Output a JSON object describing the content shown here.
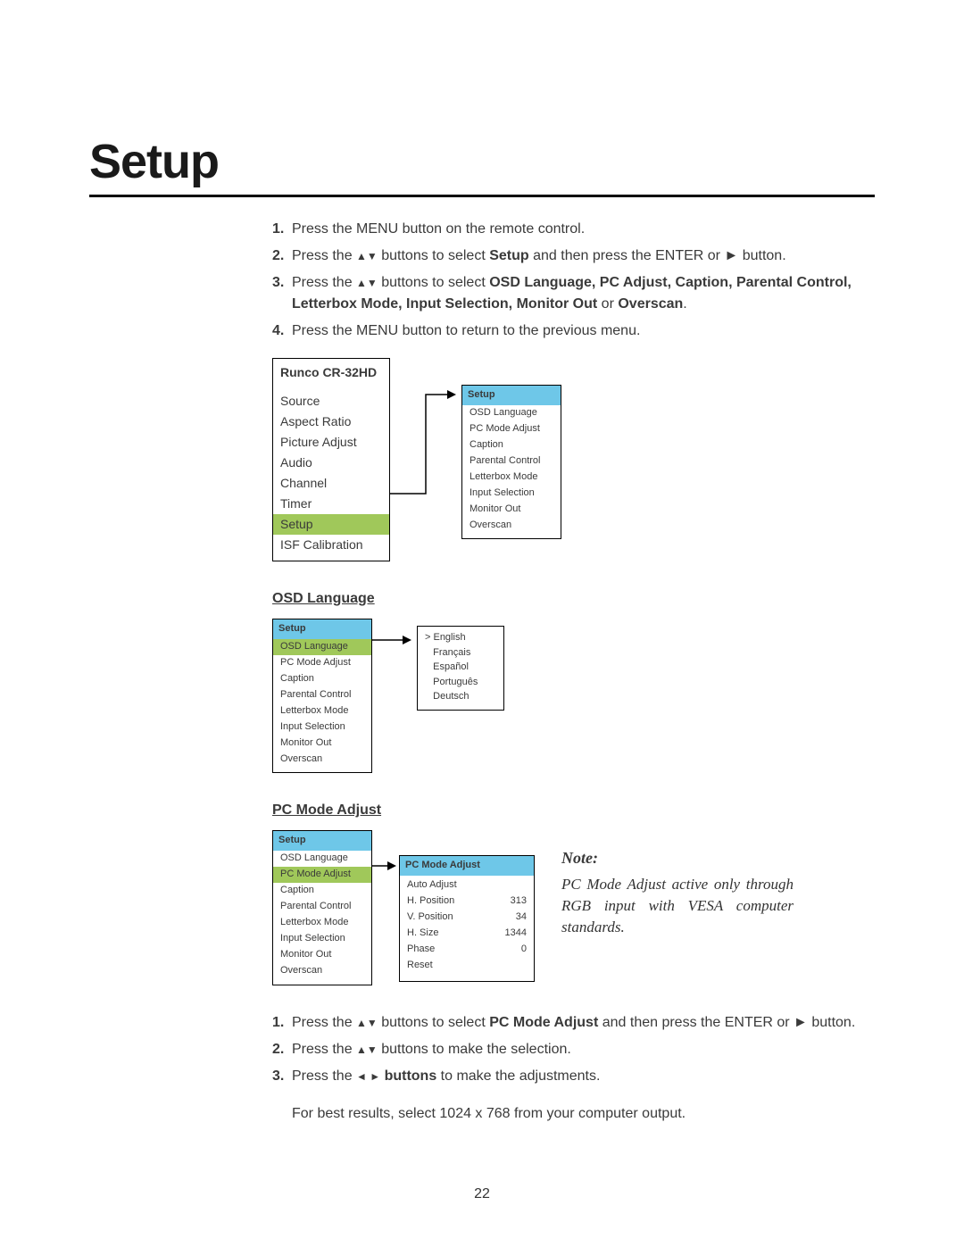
{
  "title": "Setup",
  "page_number": "22",
  "steps_top": [
    {
      "n": "1.",
      "pre": "Press the MENU button on the remote control."
    },
    {
      "n": "2.",
      "pre": "Press the ",
      "arrows": "▲▼",
      "mid": " buttons to select ",
      "bold": "Setup",
      "post": " and then press the ENTER or ► button."
    },
    {
      "n": "3.",
      "pre": "Press the ",
      "arrows": "▲▼",
      "mid": " buttons to select ",
      "bold": "OSD Language, PC Adjust, Caption, Parental Control, Letterbox Mode, Input Selection, Monitor Out",
      "post_plain": " or ",
      "bold2": "Overscan",
      "end": "."
    },
    {
      "n": "4.",
      "pre": "Press the MENU button to return to the previous menu."
    }
  ],
  "main_menu": {
    "title": "Runco CR-32HD",
    "items": [
      "Source",
      "Aspect Ratio",
      "Picture Adjust",
      "Audio",
      "Channel",
      "Timer",
      "Setup",
      "ISF Calibration"
    ],
    "highlight": "Setup"
  },
  "setup_submenu": {
    "header": "Setup",
    "items": [
      "OSD Language",
      "PC Mode Adjust",
      "Caption",
      "Parental Control",
      "Letterbox Mode",
      "Input Selection",
      "Monitor Out",
      "Overscan"
    ]
  },
  "osd_section": {
    "heading": "OSD Language",
    "menu": {
      "header": "Setup",
      "items": [
        "OSD Language",
        "PC Mode Adjust",
        "Caption",
        "Parental Control",
        "Letterbox Mode",
        "Input Selection",
        "Monitor Out",
        "Overscan"
      ],
      "highlight": "OSD Language"
    },
    "languages": {
      "selector": ">",
      "items": [
        "English",
        "Français",
        "Español",
        "Português",
        "Deutsch"
      ]
    }
  },
  "pc_section": {
    "heading": "PC Mode Adjust",
    "menu": {
      "header": "Setup",
      "items": [
        "OSD Language",
        "PC Mode Adjust",
        "Caption",
        "Parental Control",
        "Letterbox Mode",
        "Input Selection",
        "Monitor Out",
        "Overscan"
      ],
      "highlight": "PC Mode Adjust"
    },
    "pc_box": {
      "header": "PC Mode Adjust",
      "rows": [
        {
          "k": "Auto Adjust",
          "v": ""
        },
        {
          "k": "H. Position",
          "v": "313"
        },
        {
          "k": "V. Position",
          "v": "34"
        },
        {
          "k": "H. Size",
          "v": "1344"
        },
        {
          "k": "Phase",
          "v": "0"
        },
        {
          "k": "Reset",
          "v": ""
        }
      ]
    },
    "note_label": "Note:",
    "note_text": "PC Mode Adjust active only through RGB input with VESA computer standards."
  },
  "steps_bottom": [
    {
      "n": "1.",
      "pre": "Press the ",
      "arrows": "▲▼",
      "mid": " buttons to select ",
      "bold": "PC Mode Adjust",
      "post": " and then press the ENTER or ► button."
    },
    {
      "n": "2.",
      "pre": "Press the ",
      "arrows": "▲▼",
      "post": " buttons to make the selection."
    },
    {
      "n": "3.",
      "pre": "Press the ",
      "arrows": "◄ ►",
      "mid_bold": " buttons",
      "post": " to make the adjustments."
    }
  ],
  "footer_line": "For best results, select 1024 x 768 from your computer output."
}
